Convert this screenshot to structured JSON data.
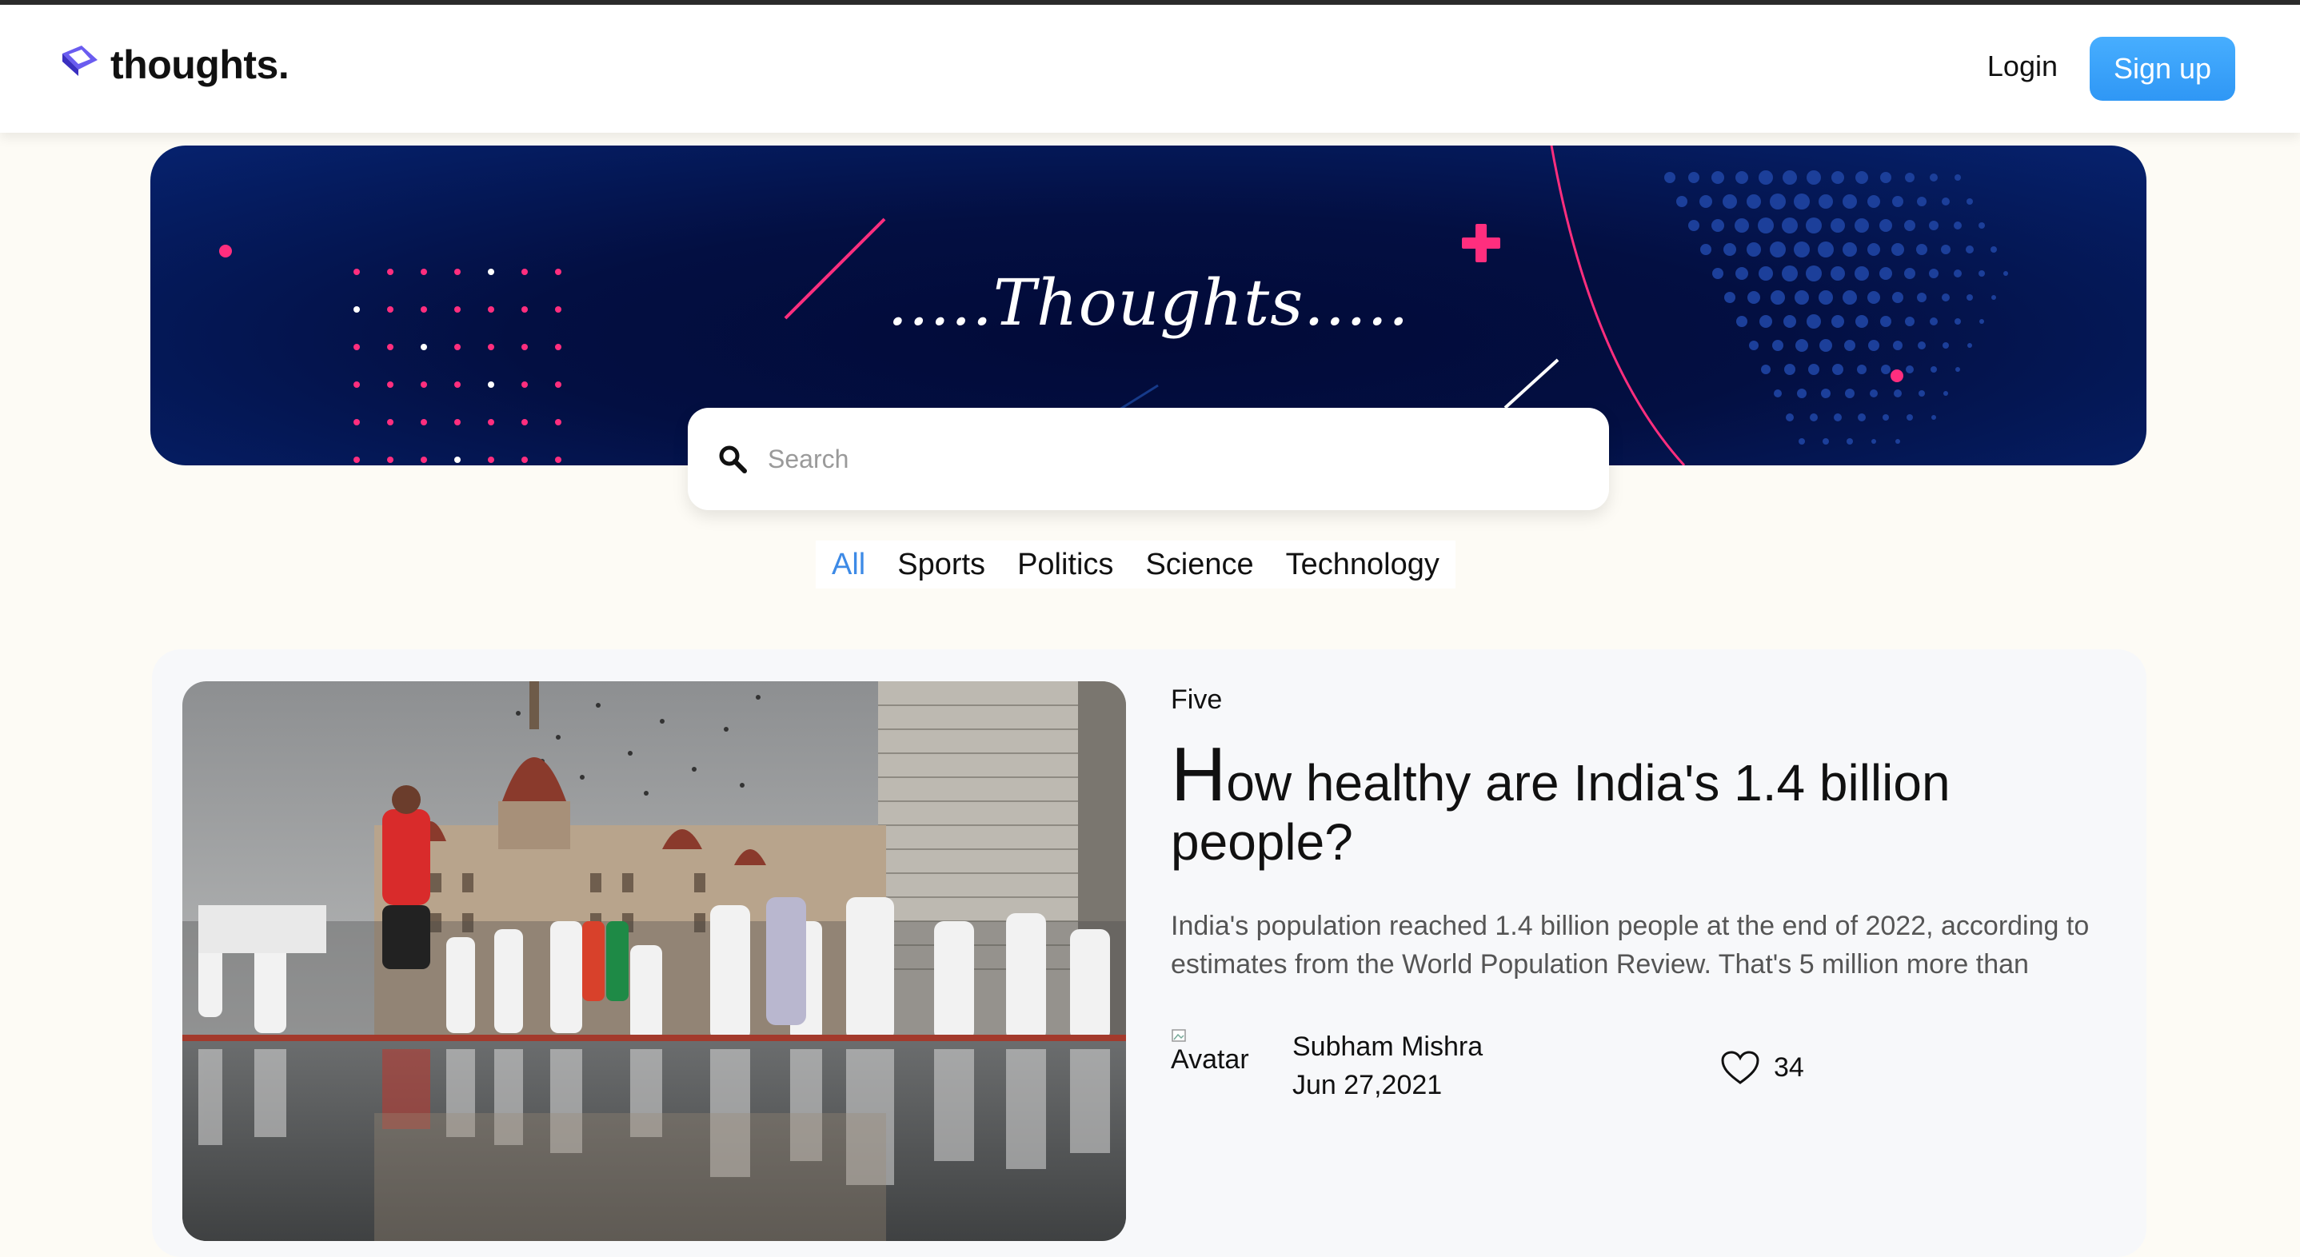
{
  "brand": {
    "name": "thoughts.",
    "accent": "#4f46e5"
  },
  "header": {
    "login_label": "Login",
    "signup_label": "Sign up",
    "signup_color": "#3aa2fb"
  },
  "hero": {
    "title": ".....Thoughts....."
  },
  "search": {
    "placeholder": "Search",
    "icon": "search-icon"
  },
  "tabs": [
    {
      "label": "All",
      "active": true
    },
    {
      "label": "Sports",
      "active": false
    },
    {
      "label": "Politics",
      "active": false
    },
    {
      "label": "Science",
      "active": false
    },
    {
      "label": "Technology",
      "active": false
    }
  ],
  "post": {
    "category": "Five",
    "title_first_letter": "H",
    "title_rest": "ow healthy are India's 1.4 billion people?",
    "excerpt": "India's population reached 1.4 billion people at the end of 2022, according to estimates from the World Population Review. That's 5 million more than",
    "avatar_alt": "Avatar",
    "author": "Subham Mishra",
    "date": "Jun 27,2021",
    "likes": "34",
    "like_icon": "heart-icon"
  },
  "colors": {
    "tab_active": "#3d8ae6",
    "hero_pink": "#ff2e7e",
    "hero_navy": "#030f42"
  }
}
